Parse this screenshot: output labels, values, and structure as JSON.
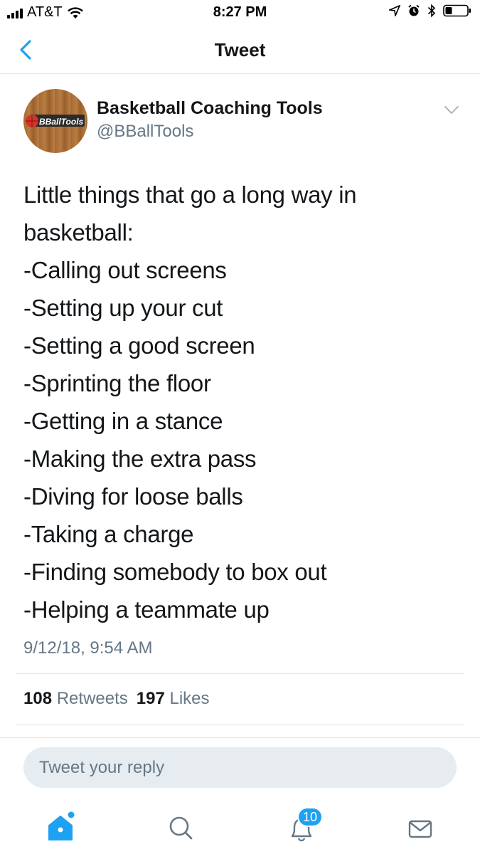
{
  "status_bar": {
    "carrier": "AT&T",
    "time": "8:27 PM"
  },
  "header": {
    "title": "Tweet"
  },
  "tweet": {
    "author_name": "Basketball Coaching Tools",
    "author_handle": "@BBallTools",
    "avatar_logo_text": "BBallTools",
    "lines": [
      "Little things that go a long way in",
      "basketball:",
      "-Calling out screens",
      "-Setting up your cut",
      "-Setting a good screen",
      "-Sprinting the floor",
      "-Getting in a stance",
      "-Making the extra pass",
      "-Diving for loose balls",
      "-Taking a charge",
      "-Finding somebody to box out",
      "-Helping a teammate up"
    ],
    "timestamp": "9/12/18, 9:54 AM"
  },
  "stats": {
    "retweets_count": "108",
    "retweets_label": "Retweets",
    "likes_count": "197",
    "likes_label": "Likes"
  },
  "reply": {
    "placeholder": "Tweet your reply"
  },
  "tabbar": {
    "items": [
      {
        "name": "home",
        "icon": "home-icon"
      },
      {
        "name": "search",
        "icon": "search-icon"
      },
      {
        "name": "notifications",
        "icon": "bell-icon"
      },
      {
        "name": "messages",
        "icon": "mail-icon"
      }
    ],
    "notifications_badge": "10"
  },
  "colors": {
    "accent": "#1da1f2",
    "text_primary": "#14171a",
    "text_secondary": "#657786",
    "divider": "#e1e8ed",
    "reply_bg": "#e6ecf0"
  }
}
